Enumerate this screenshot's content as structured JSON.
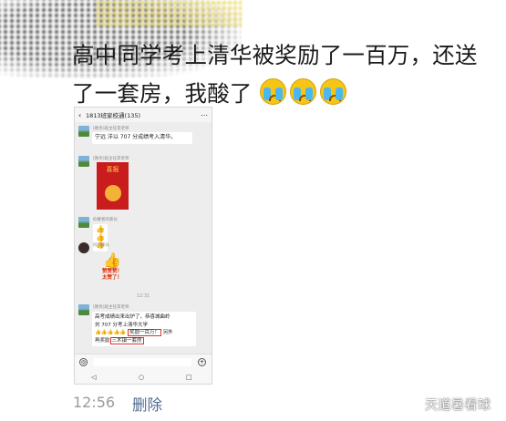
{
  "post": {
    "line1": "高中同学考上清华被奖励了一百万，还送",
    "line2": "了一套房，我酸了"
  },
  "phone": {
    "header_title": "1813班家校通(135)",
    "msg1_name": "[教务]班主任李老师",
    "msg1_text": "宁远      洋以 707 分成绩考入清华。",
    "msg2_name": "[教务]班主任李老师",
    "poster_title": "喜报",
    "msg3_name": "仰慕者的家长",
    "msg4_name": "同学家长",
    "thumb_caption1": "赞赞赞！",
    "thumb_caption2": "太赞了！",
    "timestamp": "12:31",
    "msg5_name": "[教务]班主任李老师",
    "msg5_line1": "高考成绩出来出炉了，恭喜城曲岭",
    "msg5_line2": "刘     707 分考上清华大学",
    "msg5_highlight1": "奖励一百万！",
    "msg5_line3": "另外",
    "msg5_line4": "再奖励",
    "msg5_highlight2": "三木镇一套房"
  },
  "footer": {
    "time": "12:56",
    "delete": "删除",
    "watermark": "天道暑看球"
  }
}
